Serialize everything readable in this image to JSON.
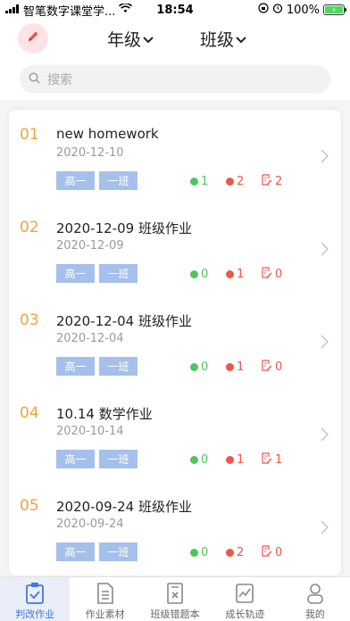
{
  "status_bar": {
    "carrier": "智笔数字课堂学...",
    "time": "18:54",
    "battery": "100%"
  },
  "header": {
    "grade_label": "年级",
    "class_label": "班级"
  },
  "search": {
    "placeholder": "搜索"
  },
  "homeworks": [
    {
      "num": "01",
      "title": "new homework",
      "date": "2020-12-10",
      "grade": "高一",
      "class": "一班",
      "green": "1",
      "red": "2",
      "edit": "2"
    },
    {
      "num": "02",
      "title": "2020-12-09 班级作业",
      "date": "2020-12-09",
      "grade": "高一",
      "class": "一班",
      "green": "0",
      "red": "1",
      "edit": "0"
    },
    {
      "num": "03",
      "title": "2020-12-04 班级作业",
      "date": "2020-12-04",
      "grade": "高一",
      "class": "一班",
      "green": "0",
      "red": "1",
      "edit": "0"
    },
    {
      "num": "04",
      "title": "10.14 数学作业",
      "date": "2020-10-14",
      "grade": "高一",
      "class": "一班",
      "green": "0",
      "red": "1",
      "edit": "1"
    },
    {
      "num": "05",
      "title": "2020-09-24 班级作业",
      "date": "2020-09-24",
      "grade": "高一",
      "class": "一班",
      "green": "0",
      "red": "2",
      "edit": "0"
    }
  ],
  "tabs": [
    {
      "label": "判改作业",
      "icon": "clipboard-check-icon"
    },
    {
      "label": "作业素材",
      "icon": "document-list-icon"
    },
    {
      "label": "班级错题本",
      "icon": "error-book-icon"
    },
    {
      "label": "成长轨迹",
      "icon": "chart-line-icon"
    },
    {
      "label": "我的",
      "icon": "person-icon"
    }
  ],
  "colors": {
    "accent": "#3f78e0",
    "number": "#f2a33a",
    "tag": "#a6c0ec",
    "green": "#4cc75a",
    "red": "#f0564a"
  }
}
